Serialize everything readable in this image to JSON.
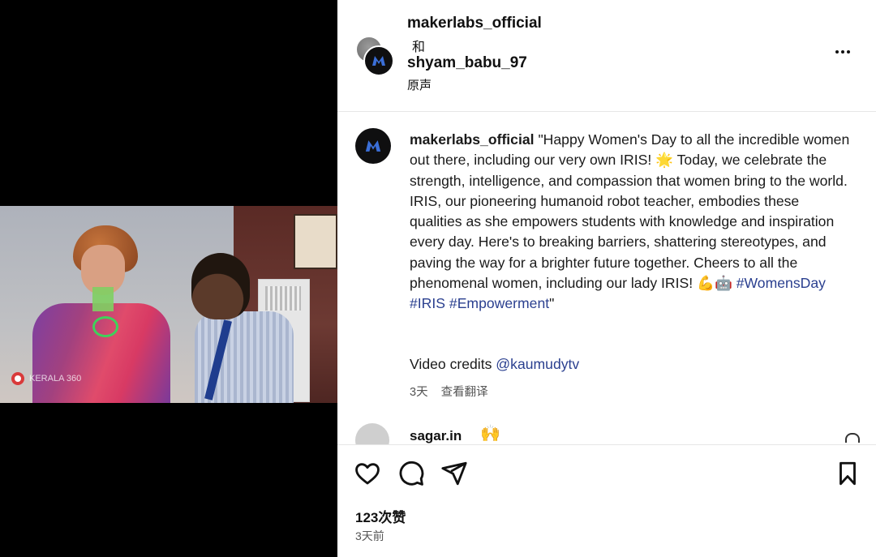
{
  "post": {
    "author": "makerlabs_official",
    "collab_conjunction": "和",
    "collaborator": "shyam_babu_97",
    "audio": "原声"
  },
  "video": {
    "watermark_text": "KERALA 360"
  },
  "caption": {
    "username": "makerlabs_official",
    "text_part1": "\"Happy Women's Day to all the incredible women out there, including our very own IRIS! 🌟 Today, we celebrate the strength, intelligence, and compassion that women bring to the world. IRIS, our pioneering humanoid robot teacher, embodies these qualities as she empowers students with knowledge and inspiration every day. Here's to breaking barriers, shattering stereotypes, and paving the way for a brighter future together. Cheers to all the phenomenal women, including our lady IRIS! 💪🤖 ",
    "hashtags": [
      "#WomensDay",
      "#IRIS",
      "#Empowerment"
    ],
    "closing_quote": "\"",
    "credits_label": "Video credits ",
    "credits_mention": "@kaumudytv",
    "age": "3天",
    "translate": "查看翻译"
  },
  "comment": {
    "username": "sagar.in",
    "emoji": "🙌"
  },
  "stats": {
    "likes": "123次赞",
    "time_ago": "3天前"
  },
  "icons": {
    "more": "more-icon",
    "like": "heart-icon",
    "comment": "comment-icon",
    "share": "share-icon",
    "save": "bookmark-icon"
  },
  "colors": {
    "hashtag": "#2a3f8f",
    "avatar_bg": "#0f0f10",
    "logo_blue": "#3b6fd8"
  }
}
